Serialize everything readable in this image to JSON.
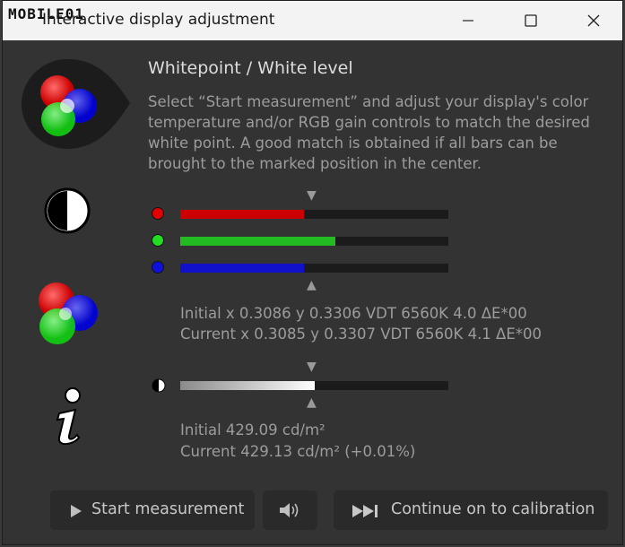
{
  "window": {
    "title": "Interactive display adjustment",
    "logo_text": "MOBILE01"
  },
  "titlebar_buttons": {
    "minimize": "minimize-icon",
    "maximize": "maximize-icon",
    "close": "close-icon"
  },
  "main": {
    "heading": "Whitepoint / White level",
    "description": "Select “Start measurement” and adjust your display's color temperature and/or RGB gain controls to match the desired white point. A good match is obtained if all bars can be brought to the marked position in the center."
  },
  "rgb_bars": {
    "marker": "▲",
    "marker_top": "▼",
    "items": [
      {
        "channel": "red",
        "color": "#cc0000",
        "level": 0.46
      },
      {
        "channel": "green",
        "color": "#22bb22",
        "level": 0.58
      },
      {
        "channel": "blue",
        "color": "#1111cc",
        "level": 0.46
      }
    ]
  },
  "whitepoint": {
    "initial": "Initial x 0.3086 y 0.3306 VDT 6560K 4.0 ΔE*00",
    "current": "Current x 0.3085 y 0.3307 VDT 6560K 4.1 ΔE*00"
  },
  "luminance_bar": {
    "level": 0.5,
    "marker": "▲",
    "marker_top": "▼"
  },
  "luminance": {
    "initial": "Initial 429.09 cd/m²",
    "current": "Current 429.13 cd/m² (+0.01%)"
  },
  "buttons": {
    "start_label": "Start measurement",
    "sound_icon": "speaker-icon",
    "continue_label": "Continue on to calibration"
  }
}
